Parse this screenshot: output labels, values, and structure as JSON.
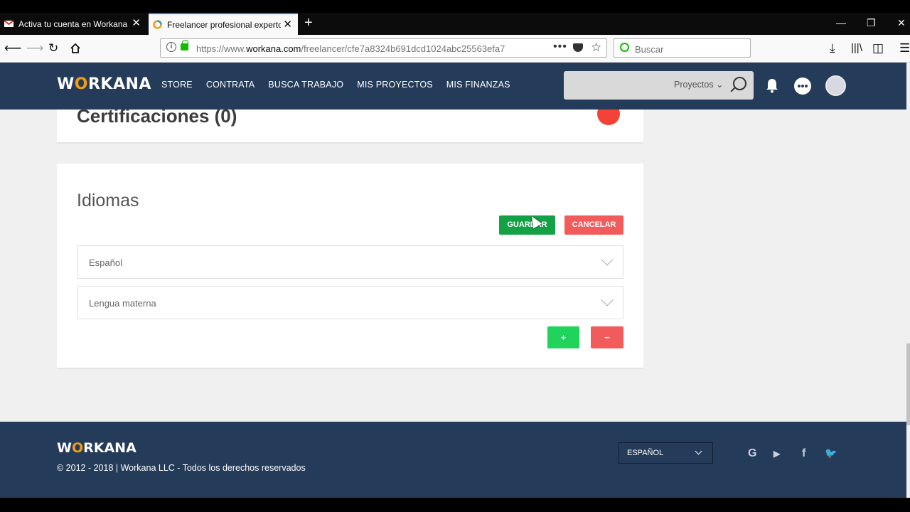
{
  "browser": {
    "tabs": [
      {
        "label": "Activa tu cuenta en Workana",
        "active": false
      },
      {
        "label": "Freelancer profesional experto",
        "active": true
      }
    ],
    "url_prefix": "https://www.",
    "url_domain": "workana.com",
    "url_path": "/freelancer/cfe7a8324b691dcd1024abc25563efa7",
    "search_placeholder": "Buscar",
    "new_tab": "+",
    "close_glyph": "✕"
  },
  "site": {
    "logo_w": "W",
    "logo_o": "O",
    "logo_rest": "RKANA",
    "nav": [
      "STORE",
      "CONTRATA",
      "BUSCA TRABAJO",
      "MIS PROYECTOS",
      "MIS FINANZAS"
    ],
    "search_dropdown": "Proyectos ⌄",
    "certifications_title": "Certificaciones (0)",
    "languages": {
      "title": "Idiomas",
      "save_label": "GUARDAR",
      "cancel_label": "CANCELAR",
      "language_value": "Español",
      "level_value": "Lengua materna",
      "add_label": "+",
      "remove_label": "−"
    }
  },
  "footer": {
    "logo_w": "W",
    "logo_o": "O",
    "logo_rest": "RKANA",
    "copyright": "© 2012 - 2018 | Workana LLC - Todos los derechos reservados",
    "language": "ESPAÑOL",
    "social": [
      "G",
      "▶",
      "f",
      "🐦"
    ]
  },
  "colors": {
    "navy": "#253b5a",
    "save_green": "#12a144",
    "add_green": "#1fd35b",
    "danger_red": "#f25b5b",
    "logo_orange": "#f39c12"
  }
}
